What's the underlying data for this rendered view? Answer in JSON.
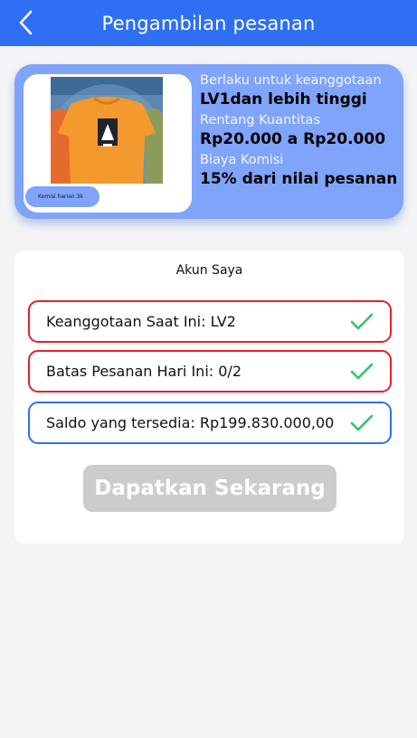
{
  "header": {
    "title": "Pengambilan pesanan",
    "back_icon": "chevron-left-icon"
  },
  "product": {
    "commission_badge": "Komisi harian 3k",
    "membership_label": "Berlaku untuk keanggotaan",
    "membership_value": "LV1dan lebih tinggi",
    "quantity_label": "Rentang Kuantitas",
    "quantity_value": "Rp20.000 a Rp20.000",
    "fee_label": "Biaya Komisi",
    "fee_value": "15% dari nilai pesanan"
  },
  "account": {
    "title": "Akun Saya",
    "rows": [
      {
        "text": "Keanggotaan Saat Ini: LV2",
        "icon": "check-icon",
        "border": "#e5202a"
      },
      {
        "text": "Batas Pesanan Hari Ini: 0/2",
        "icon": "check-icon",
        "border": "#e5202a"
      },
      {
        "text": "Saldo yang tersedia: Rp199.830.000,00",
        "icon": "check-icon",
        "border": "#2f6ff4"
      }
    ],
    "button_label": "Dapatkan Sekarang"
  },
  "colors": {
    "header_bg": "#2f6ff4",
    "card_bg": "#7fa4fa",
    "check": "#2fc46a",
    "button_disabled": "#cccccc"
  }
}
